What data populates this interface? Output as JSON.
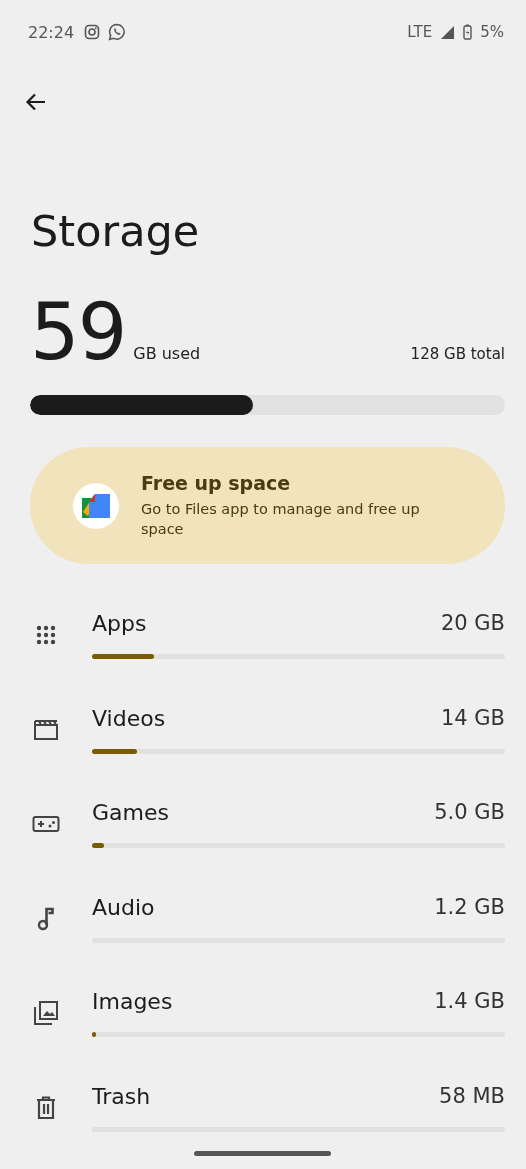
{
  "status_bar": {
    "time": "22:24",
    "network": "LTE",
    "battery": "5%"
  },
  "title": "Storage",
  "usage": {
    "used": "59",
    "used_unit": "GB used",
    "total": "128 GB total",
    "level": 0.47
  },
  "card": {
    "title": "Free up space",
    "text": "Go to Files app to manage and free up space"
  },
  "categories": [
    {
      "kind": "apps",
      "label": "Apps",
      "size": "20 GB",
      "level": 0.15
    },
    {
      "kind": "videos",
      "label": "Videos",
      "size": "14 GB",
      "level": 0.11
    },
    {
      "kind": "games",
      "label": "Games",
      "size": "5.0 GB",
      "level": 0.03
    },
    {
      "kind": "audio",
      "label": "Audio",
      "size": "1.2 GB"
    },
    {
      "kind": "images",
      "label": "Images",
      "size": "1.4 GB",
      "level": 0.01
    },
    {
      "kind": "trash",
      "label": "Trash",
      "size": "58 MB"
    }
  ]
}
